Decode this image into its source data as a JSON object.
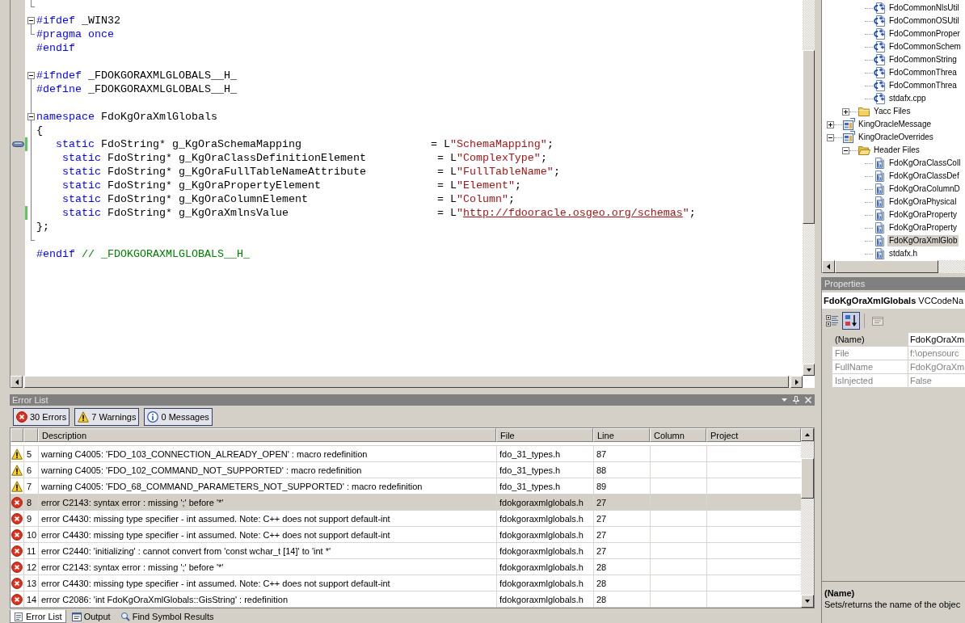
{
  "editor": {
    "lines": [
      {
        "kind": "end",
        "changed": false,
        "bookmarked": false
      },
      {
        "kind": "start",
        "expanded": true,
        "changed": false,
        "bookmarked": false,
        "tokens": [
          {
            "kind": "keyword",
            "text": "#ifdef"
          },
          {
            "kind": "plain",
            "text": " _WIN32"
          }
        ]
      },
      {
        "kind": "end",
        "changed": false,
        "bookmarked": false,
        "tokens": [
          {
            "kind": "keyword",
            "text": "#pragma once"
          }
        ]
      },
      {
        "kind": "plain",
        "changed": false,
        "bookmarked": false,
        "tokens": [
          {
            "kind": "keyword",
            "text": "#endif"
          }
        ]
      },
      {
        "kind": "plain",
        "changed": false,
        "bookmarked": false
      },
      {
        "kind": "start",
        "expanded": true,
        "changed": false,
        "bookmarked": false,
        "tokens": [
          {
            "kind": "keyword",
            "text": "#ifndef"
          },
          {
            "kind": "plain",
            "text": " _FDOKGORAXMLGLOBALS__H_"
          }
        ]
      },
      {
        "kind": "inner",
        "changed": false,
        "bookmarked": false,
        "tokens": [
          {
            "kind": "keyword",
            "text": "#define"
          },
          {
            "kind": "plain",
            "text": " _FDOKGORAXMLGLOBALS__H_"
          }
        ]
      },
      {
        "kind": "inner",
        "changed": false,
        "bookmarked": false
      },
      {
        "kind": "start",
        "expanded": true,
        "changed": false,
        "bookmarked": false,
        "tokens": [
          {
            "kind": "keyword",
            "text": "namespace"
          },
          {
            "kind": "plain",
            "text": " FdoKgOraXmlGlobals"
          }
        ]
      },
      {
        "kind": "inner",
        "changed": false,
        "bookmarked": false,
        "tokens": [
          {
            "kind": "plain",
            "text": "{"
          }
        ]
      },
      {
        "kind": "inner",
        "changed": true,
        "bookmarked": true,
        "tokens": [
          {
            "kind": "keyword",
            "text": "   static"
          },
          {
            "kind": "plain",
            "text": " FdoString* g_KgOraSchemaMapping                    = L"
          },
          {
            "kind": "string",
            "text": "\"SchemaMapping\""
          },
          {
            "kind": "plain",
            "text": ";"
          }
        ]
      },
      {
        "kind": "inner",
        "changed": false,
        "bookmarked": false,
        "tokens": [
          {
            "kind": "keyword",
            "text": "    static"
          },
          {
            "kind": "plain",
            "text": " FdoString* g_KgOraClassDefinitionElement           = L"
          },
          {
            "kind": "string",
            "text": "\"ComplexType\""
          },
          {
            "kind": "plain",
            "text": ";"
          }
        ]
      },
      {
        "kind": "inner",
        "changed": false,
        "bookmarked": false,
        "tokens": [
          {
            "kind": "keyword",
            "text": "    static"
          },
          {
            "kind": "plain",
            "text": " FdoString* g_KgOraFullTableNameAttribute           = L"
          },
          {
            "kind": "string",
            "text": "\"FullTableName\""
          },
          {
            "kind": "plain",
            "text": ";"
          }
        ]
      },
      {
        "kind": "inner",
        "changed": false,
        "bookmarked": false,
        "tokens": [
          {
            "kind": "keyword",
            "text": "    static"
          },
          {
            "kind": "plain",
            "text": " FdoString* g_KgOraPropertyElement                  = L"
          },
          {
            "kind": "string",
            "text": "\"Element\""
          },
          {
            "kind": "plain",
            "text": ";"
          }
        ]
      },
      {
        "kind": "inner",
        "changed": false,
        "bookmarked": false,
        "tokens": [
          {
            "kind": "keyword",
            "text": "    static"
          },
          {
            "kind": "plain",
            "text": " FdoString* g_KgOraColumnElement                    = L"
          },
          {
            "kind": "string",
            "text": "\"Column\""
          },
          {
            "kind": "plain",
            "text": ";"
          }
        ]
      },
      {
        "kind": "inner",
        "changed": true,
        "bookmarked": false,
        "tokens": [
          {
            "kind": "keyword",
            "text": "    static"
          },
          {
            "kind": "plain",
            "text": " FdoString* g_KgOraXmlnsValue                       = L"
          },
          {
            "kind": "string",
            "text": "\""
          },
          {
            "kind": "link",
            "text": "http://fdooracle.osgeo.org/schemas"
          },
          {
            "kind": "string",
            "text": "\""
          },
          {
            "kind": "plain",
            "text": ";"
          }
        ]
      },
      {
        "kind": "inner",
        "changed": false,
        "bookmarked": false,
        "tokens": [
          {
            "kind": "plain",
            "text": "};"
          }
        ]
      },
      {
        "kind": "end",
        "changed": false,
        "bookmarked": false
      },
      {
        "kind": "plain",
        "changed": false,
        "bookmarked": false,
        "tokens": [
          {
            "kind": "keyword",
            "text": "#endif"
          },
          {
            "kind": "comment",
            "text": " // _FDOKGORAXMLGLOBALS__H_"
          }
        ]
      }
    ]
  },
  "solution_explorer": {
    "items": [
      {
        "children": [
          {
            "children": [
              {
                "kind": "cpp",
                "label": "FdoCommonNlsUtil",
                "selected": false
              },
              {
                "kind": "cpp",
                "label": "FdoCommonOSUtil",
                "selected": false
              },
              {
                "kind": "cpp",
                "label": "FdoCommonProper",
                "selected": false
              },
              {
                "kind": "cpp",
                "label": "FdoCommonSchem",
                "selected": false
              },
              {
                "kind": "cpp",
                "label": "FdoCommonString",
                "selected": false
              },
              {
                "kind": "cpp",
                "label": "FdoCommonThrea",
                "selected": false
              },
              {
                "kind": "cpp",
                "label": "FdoCommonThrea",
                "selected": false
              },
              {
                "kind": "cpp",
                "label": "stdafx.cpp",
                "selected": false
              }
            ]
          },
          {
            "kind": "folder",
            "label": "Yacc Files",
            "expanded": false,
            "selected": false
          }
        ]
      },
      {
        "kind": "project",
        "label": "KingOracleMessage",
        "expanded": false,
        "selected": false
      },
      {
        "kind": "project",
        "label": "KingOracleOverrides",
        "expanded": true,
        "selected": false,
        "children": [
          {
            "kind": "folder",
            "label": "Header Files",
            "expanded": true,
            "selected": false,
            "children": [
              {
                "kind": "header",
                "label": "FdoKgOraClassColl",
                "selected": false
              },
              {
                "kind": "header",
                "label": "FdoKgOraClassDef",
                "selected": false
              },
              {
                "kind": "header",
                "label": "FdoKgOraColumnD",
                "selected": false
              },
              {
                "kind": "header",
                "label": "FdoKgOraPhysical",
                "selected": false
              },
              {
                "kind": "header",
                "label": "FdoKgOraProperty",
                "selected": false
              },
              {
                "kind": "header",
                "label": "FdoKgOraProperty",
                "selected": false
              },
              {
                "kind": "header",
                "label": "FdoKgOraXmlGlob",
                "selected": true
              },
              {
                "kind": "header",
                "label": "stdafx.h",
                "selected": false
              }
            ]
          }
        ]
      }
    ]
  },
  "error_list": {
    "title": "Error List",
    "filters": [
      {
        "kind": "error",
        "label": "30 Errors",
        "selected": true
      },
      {
        "kind": "warning",
        "label": "7 Warnings",
        "selected": true
      },
      {
        "kind": "message",
        "label": "0 Messages",
        "selected": true
      }
    ],
    "columns": [
      {
        "label": "Description"
      },
      {
        "label": "File"
      },
      {
        "label": "Line"
      },
      {
        "label": "Column"
      },
      {
        "label": "Project"
      }
    ],
    "rows": [
      {
        "kind": "warning",
        "number": "5",
        "description": "warning C4005: 'FDO_103_CONNECTION_ALREADY_OPEN' : macro redefinition",
        "file": "fdo_31_types.h",
        "line": "87",
        "selected": false
      },
      {
        "kind": "warning",
        "number": "6",
        "description": "warning C4005: 'FDO_102_COMMAND_NOT_SUPPORTED' : macro redefinition",
        "file": "fdo_31_types.h",
        "line": "88",
        "selected": false
      },
      {
        "kind": "warning",
        "number": "7",
        "description": "warning C4005: 'FDO_68_COMMAND_PARAMETERS_NOT_SUPPORTED' : macro redefinition",
        "file": "fdo_31_types.h",
        "line": "89",
        "selected": false
      },
      {
        "kind": "error",
        "number": "8",
        "description": "error C2143: syntax error : missing ';' before '*'",
        "file": "fdokgoraxmlglobals.h",
        "line": "27",
        "selected": true
      },
      {
        "kind": "error",
        "number": "9",
        "description": "error C4430: missing type specifier - int assumed. Note: C++ does not support default-int",
        "file": "fdokgoraxmlglobals.h",
        "line": "27",
        "selected": false
      },
      {
        "kind": "error",
        "number": "10",
        "description": "error C4430: missing type specifier - int assumed. Note: C++ does not support default-int",
        "file": "fdokgoraxmlglobals.h",
        "line": "27",
        "selected": false
      },
      {
        "kind": "error",
        "number": "11",
        "description": "error C2440: 'initializing' : cannot convert from 'const wchar_t [14]' to 'int *'",
        "file": "fdokgoraxmlglobals.h",
        "line": "27",
        "selected": false
      },
      {
        "kind": "error",
        "number": "12",
        "description": "error C2143: syntax error : missing ';' before '*'",
        "file": "fdokgoraxmlglobals.h",
        "line": "28",
        "selected": false
      },
      {
        "kind": "error",
        "number": "13",
        "description": "error C4430: missing type specifier - int assumed. Note: C++ does not support default-int",
        "file": "fdokgoraxmlglobals.h",
        "line": "28",
        "selected": false
      },
      {
        "kind": "error",
        "number": "14",
        "description": "error C2086: 'int FdoKgOraXmlGlobals::GisString' : redefinition",
        "file": "fdokgoraxmlglobals.h",
        "line": "28",
        "selected": false
      }
    ],
    "tabs": [
      {
        "kind": "error_list",
        "label": "Error List",
        "selected": true
      },
      {
        "kind": "output",
        "label": "Output",
        "selected": false
      },
      {
        "kind": "find",
        "label": "Find Symbol Results",
        "selected": false
      }
    ]
  },
  "properties": {
    "title": "Properties",
    "object": {
      "name": "FdoKgOraXmlGlobals",
      "type": "VCCodeNa"
    },
    "toolbar": [
      {
        "kind": "categorized",
        "selected": false,
        "disabled": false
      },
      {
        "kind": "alphabetical",
        "selected": true,
        "disabled": false
      },
      {
        "kind": "property_pages",
        "selected": false,
        "disabled": true
      }
    ],
    "rows": [
      {
        "name": "(Name)",
        "value": "FdoKgOraXm",
        "selected": true,
        "read_only": false
      },
      {
        "name": "File",
        "value": "f:\\opensourc",
        "selected": false,
        "read_only": true
      },
      {
        "name": "FullName",
        "value": "FdoKgOraXm",
        "selected": false,
        "read_only": true
      },
      {
        "name": "IsInjected",
        "value": "False",
        "selected": false,
        "read_only": true
      }
    ],
    "description": {
      "title": "(Name)",
      "text": "Sets/returns the name of the objec"
    }
  }
}
